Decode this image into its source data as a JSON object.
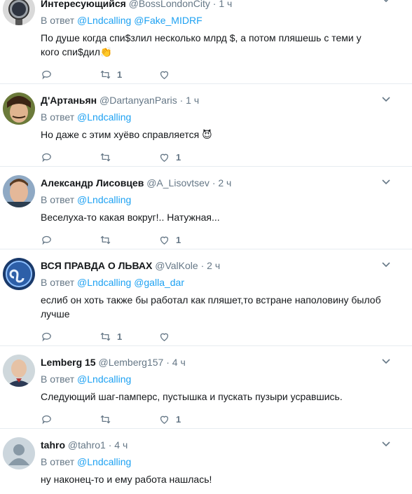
{
  "reply_prefix": "В ответ",
  "tweets": [
    {
      "name": "Интересующийся",
      "handle": "@BossLondonCity",
      "time": "1 ч",
      "mentions": [
        "@Lndcalling",
        "@Fake_MIDRF"
      ],
      "text": "По душе когда спи$злил несколько млрд $, а потом  пляшешь с теми у кого спи$дил",
      "emoji": "👏",
      "avatar_icon": "watch-avatar",
      "retweets": "1",
      "likes": ""
    },
    {
      "name": "Д'Артаньян",
      "handle": "@DartanyanParis",
      "time": "1 ч",
      "mentions": [
        "@Lndcalling"
      ],
      "text": "Но даже с этим хуёво справляется",
      "emoji": "😈",
      "avatar_icon": "musketeer-avatar",
      "retweets": "",
      "likes": "1"
    },
    {
      "name": "Александр Лисовцев",
      "handle": "@A_Lisovtsev",
      "time": "2 ч",
      "mentions": [
        "@Lndcalling"
      ],
      "text": "Веселуха-то какая вокруг!.. Натужная...",
      "emoji": "",
      "avatar_icon": "man-avatar",
      "retweets": "",
      "likes": "1"
    },
    {
      "name": "ВСЯ ПРАВДА О ЛЬВАХ",
      "handle": "@ValKole",
      "time": "2 ч",
      "mentions": [
        "@Lndcalling",
        "@galla_dar"
      ],
      "text": "еслиб он хоть также бы работал как пляшет,то встране наполовину былоб лучше",
      "emoji": "",
      "avatar_icon": "leo-zodiac-avatar",
      "retweets": "1",
      "likes": ""
    },
    {
      "name": "Lemberg 15",
      "handle": "@Lemberg157",
      "time": "4 ч",
      "mentions": [
        "@Lndcalling"
      ],
      "text": "Следующий шаг-памперс, пустышка и пускать пузыри усравшись.",
      "emoji": "",
      "avatar_icon": "portrait-avatar",
      "retweets": "",
      "likes": "1"
    },
    {
      "name": "tahro",
      "handle": "@tahro1",
      "time": "4 ч",
      "mentions": [
        "@Lndcalling"
      ],
      "text": "ну наконец-то и ему работа нашлась!",
      "emoji": "",
      "avatar_icon": "default-avatar",
      "retweets": "",
      "likes": ""
    }
  ]
}
